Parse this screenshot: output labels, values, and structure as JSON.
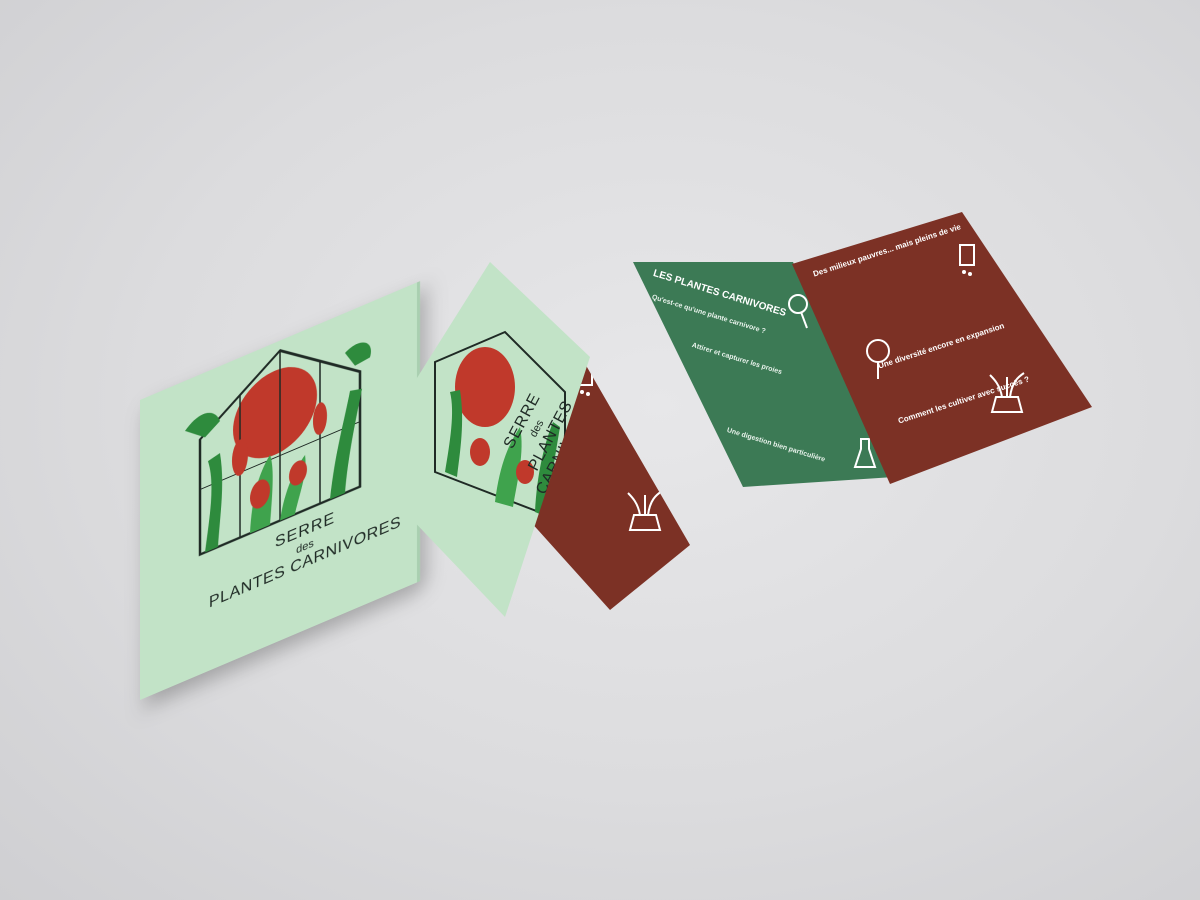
{
  "cover": {
    "line1": "SERRE",
    "line2": "des",
    "line3": "PLANTES CARNIVORES"
  },
  "inside_left": {
    "title": "LES PLANTES CARNIVORES",
    "q1": "Qu'est-ce qu'une plante carnivore ?",
    "q2": "Attirer et capturer les proies",
    "q3": "Une digestion bien particulière"
  },
  "inside_right": {
    "h1": "Des milieux pauvres... mais pleins de vie",
    "h2": "Une diversité encore en expansion",
    "h3": "Comment les cultiver avec succès ?"
  },
  "colors": {
    "cover_green": "#c2e3c7",
    "inside_green": "#3c7a55",
    "inside_red": "#7c3125",
    "background": "#dcdcde"
  }
}
